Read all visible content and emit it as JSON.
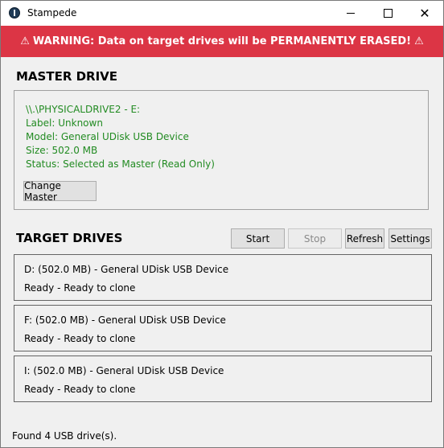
{
  "window": {
    "title": "Stampede",
    "app_icon": "stampede-app-icon",
    "controls": {
      "minimize": "—",
      "maximize": "☐",
      "close": "✕"
    }
  },
  "warning": {
    "icon": "⚠",
    "text": "WARNING: Data on target drives will be PERMANENTLY ERASED!",
    "background": "#dc3545"
  },
  "master": {
    "heading": "MASTER DRIVE",
    "lines": [
      "\\\\.\\PHYSICALDRIVE2 - E:",
      "Label: Unknown",
      "Model: General UDisk USB Device",
      "Size: 502.0 MB",
      "Status: Selected as Master (Read Only)"
    ],
    "text_color": "#228b22",
    "change_button": "Change Master"
  },
  "targets": {
    "heading": "TARGET DRIVES",
    "buttons": {
      "start": "Start",
      "stop": "Stop",
      "refresh": "Refresh",
      "settings": "Settings"
    },
    "drives": [
      {
        "name": "D: (502.0 MB) - General UDisk USB Device",
        "status": "Ready - Ready to clone"
      },
      {
        "name": "F: (502.0 MB) - General UDisk USB Device",
        "status": "Ready - Ready to clone"
      },
      {
        "name": "I: (502.0 MB) - General UDisk USB Device",
        "status": "Ready - Ready to clone"
      }
    ]
  },
  "status_bar": {
    "text": "Found 4 USB drive(s)."
  }
}
